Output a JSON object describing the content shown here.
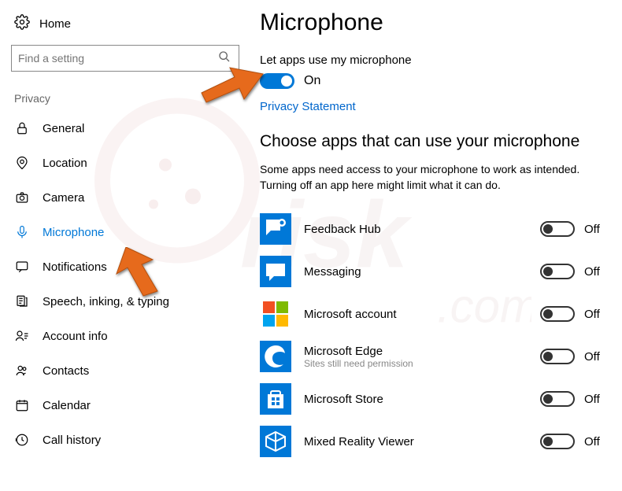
{
  "home_label": "Home",
  "search": {
    "placeholder": "Find a setting"
  },
  "section_label": "Privacy",
  "nav": [
    {
      "key": "general",
      "label": "General"
    },
    {
      "key": "location",
      "label": "Location"
    },
    {
      "key": "camera",
      "label": "Camera"
    },
    {
      "key": "microphone",
      "label": "Microphone",
      "active": true
    },
    {
      "key": "notifications",
      "label": "Notifications"
    },
    {
      "key": "speech",
      "label": "Speech, inking, & typing"
    },
    {
      "key": "account",
      "label": "Account info"
    },
    {
      "key": "contacts",
      "label": "Contacts"
    },
    {
      "key": "calendar",
      "label": "Calendar"
    },
    {
      "key": "callhistory",
      "label": "Call history"
    }
  ],
  "page": {
    "title": "Microphone",
    "allow_label": "Let apps use my microphone",
    "toggle_state": "On",
    "privacy_link": "Privacy Statement",
    "choose_title": "Choose apps that can use your microphone",
    "choose_desc": "Some apps need access to your microphone to work as intended. Turning off an app here might limit what it can do."
  },
  "apps": [
    {
      "name": "Feedback Hub",
      "state": "Off",
      "icon": "feedback"
    },
    {
      "name": "Messaging",
      "state": "Off",
      "icon": "messaging"
    },
    {
      "name": "Microsoft account",
      "state": "Off",
      "icon": "msaccount"
    },
    {
      "name": "Microsoft Edge",
      "sub": "Sites still need permission",
      "state": "Off",
      "icon": "edge"
    },
    {
      "name": "Microsoft Store",
      "state": "Off",
      "icon": "store"
    },
    {
      "name": "Mixed Reality Viewer",
      "state": "Off",
      "icon": "mixedreality"
    }
  ]
}
